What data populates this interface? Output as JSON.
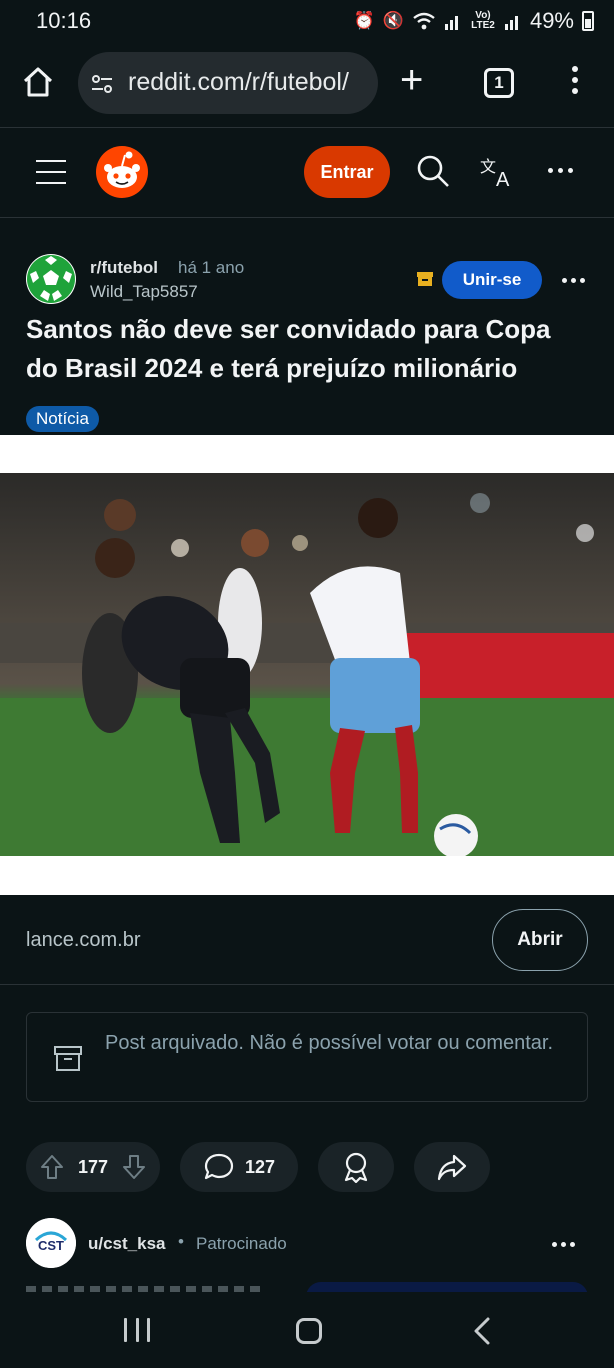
{
  "status_bar": {
    "time": "10:16",
    "network_label": "Vo) LTE2",
    "battery_percent": "49%",
    "icons": [
      "alarm-icon",
      "mute-icon",
      "wifi-icon",
      "signal-icon",
      "battery-icon"
    ]
  },
  "browser": {
    "url": "reddit.com/r/futebol/",
    "tab_count": "1",
    "new_tab_label": "+",
    "icons": [
      "home-icon",
      "site-settings-icon",
      "more-icon"
    ]
  },
  "header": {
    "login_label": "Entrar",
    "icons": [
      "menu-icon",
      "reddit-logo-icon",
      "search-icon",
      "translate-icon",
      "more-icon"
    ],
    "accent_color": "#d93900"
  },
  "post": {
    "subreddit": "r/futebol",
    "age": "há 1 ano",
    "author": "Wild_Tap5857",
    "join_label": "Unir-se",
    "title": "Santos não deve ser convidado para Copa do Brasil 2024 e terá prejuízo milionário",
    "flair": "Notícia",
    "link_domain": "lance.com.br",
    "open_label": "Abrir",
    "archived_notice": "Post arquivado. Não é possível votar ou comentar.",
    "upvotes": "177",
    "comments": "127",
    "join_color": "#115bca",
    "flair_color": "#0e5aa7"
  },
  "sponsored": {
    "user": "u/cst_ksa",
    "separator": "•",
    "label": "Patrocinado",
    "logo_text": "CST"
  },
  "nav_bar": {
    "icons": [
      "recents-icon",
      "home-button-icon",
      "back-icon"
    ]
  }
}
